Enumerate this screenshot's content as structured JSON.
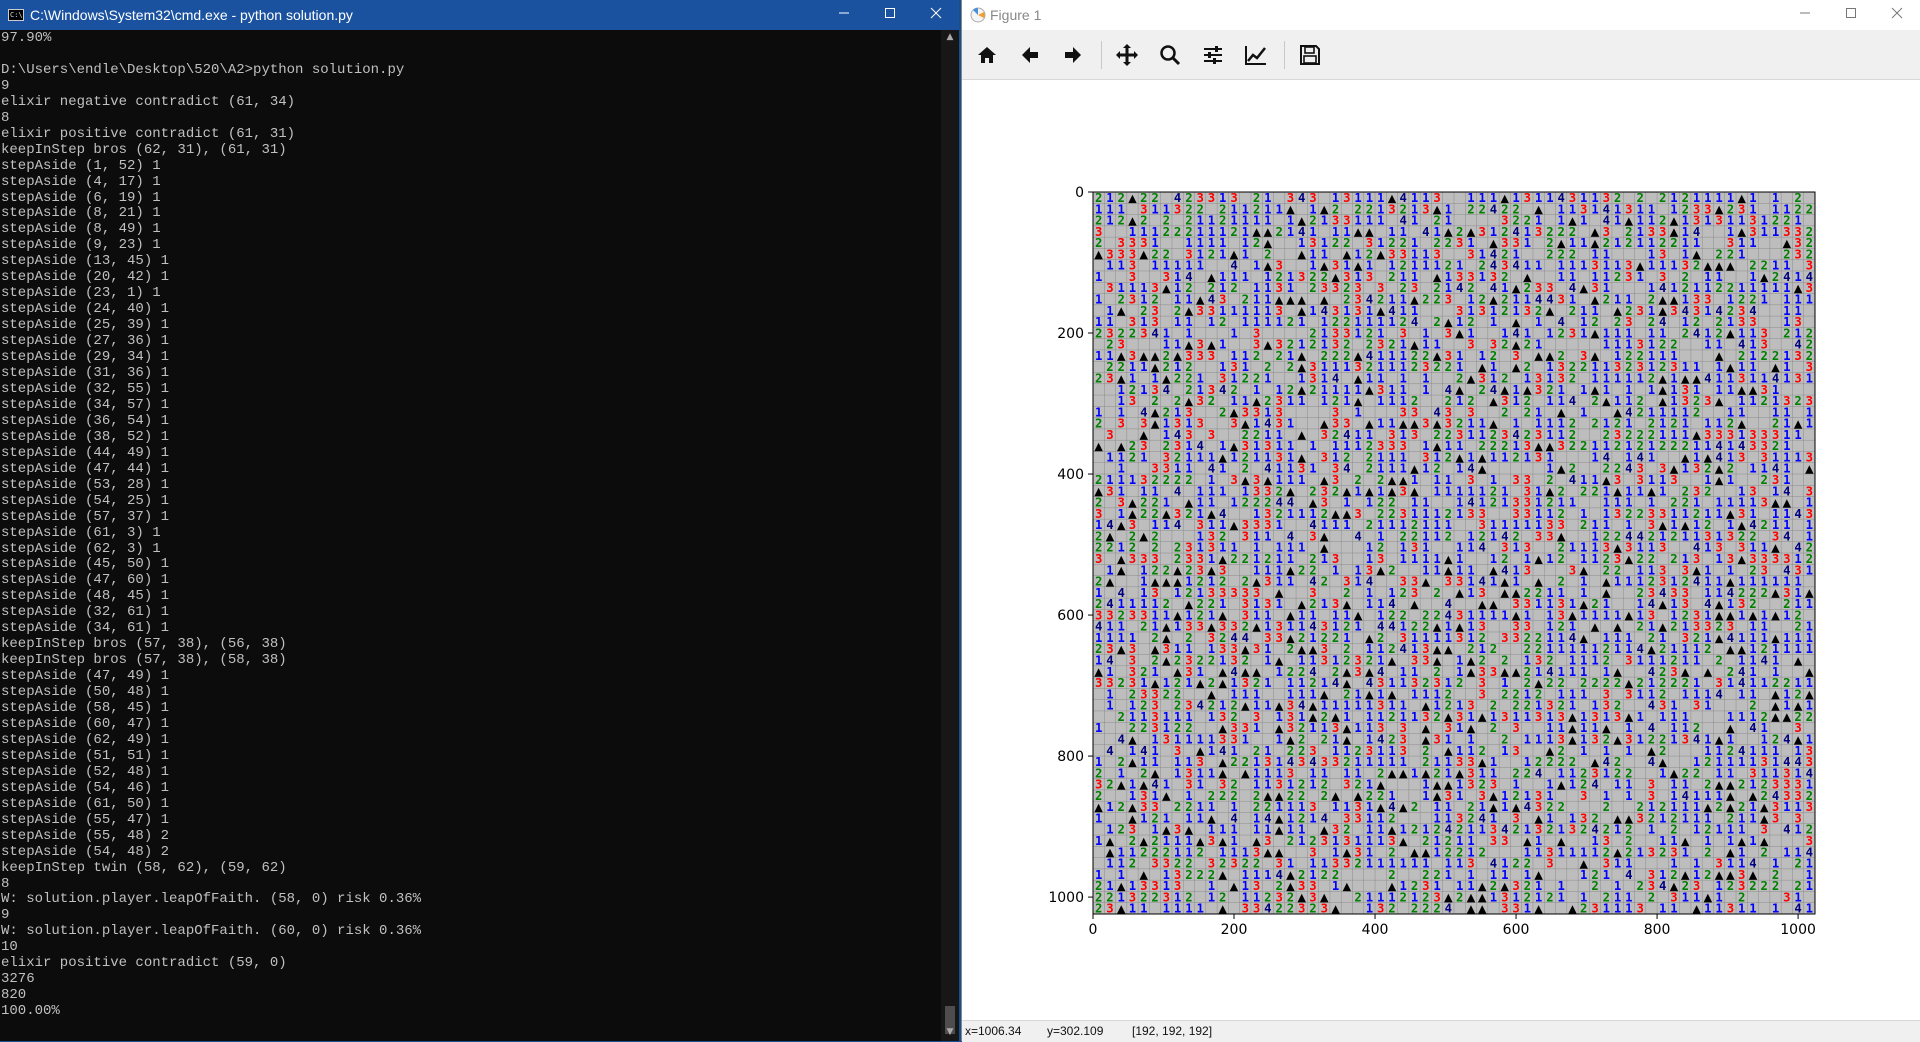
{
  "cmd": {
    "title": "C:\\Windows\\System32\\cmd.exe - python  solution.py",
    "icon_label": "C:\\",
    "lines": [
      "97.90%",
      "",
      "D:\\Users\\endle\\Desktop\\520\\A2>python solution.py",
      "9",
      "elixir negative contradict (61, 34)",
      "8",
      "elixir positive contradict (61, 31)",
      "keepInStep bros (62, 31), (61, 31)",
      "stepAside (1, 52) 1",
      "stepAside (4, 17) 1",
      "stepAside (6, 19) 1",
      "stepAside (8, 21) 1",
      "stepAside (8, 49) 1",
      "stepAside (9, 23) 1",
      "stepAside (13, 45) 1",
      "stepAside (20, 42) 1",
      "stepAside (23, 1) 1",
      "stepAside (24, 40) 1",
      "stepAside (25, 39) 1",
      "stepAside (27, 36) 1",
      "stepAside (29, 34) 1",
      "stepAside (31, 36) 1",
      "stepAside (32, 55) 1",
      "stepAside (34, 57) 1",
      "stepAside (36, 54) 1",
      "stepAside (38, 52) 1",
      "stepAside (44, 49) 1",
      "stepAside (47, 44) 1",
      "stepAside (53, 28) 1",
      "stepAside (54, 25) 1",
      "stepAside (57, 37) 1",
      "stepAside (61, 3) 1",
      "stepAside (62, 3) 1",
      "stepAside (45, 50) 1",
      "stepAside (47, 60) 1",
      "stepAside (48, 45) 1",
      "stepAside (32, 61) 1",
      "stepAside (34, 61) 1",
      "keepInStep bros (57, 38), (56, 38)",
      "keepInStep bros (57, 38), (58, 38)",
      "stepAside (47, 49) 1",
      "stepAside (50, 48) 1",
      "stepAside (58, 45) 1",
      "stepAside (60, 47) 1",
      "stepAside (62, 49) 1",
      "stepAside (51, 51) 1",
      "stepAside (52, 48) 1",
      "stepAside (54, 46) 1",
      "stepAside (61, 50) 1",
      "stepAside (55, 47) 1",
      "stepAside (55, 48) 2",
      "stepAside (54, 48) 2",
      "keepInStep twin (58, 62), (59, 62)",
      "8",
      "W: solution.player.leapOfFaith. (58, 0) risk 0.36%",
      "9",
      "W: solution.player.leapOfFaith. (60, 0) risk 0.36%",
      "10",
      "elixir positive contradict (59, 0)",
      "3276",
      "820",
      "100.00%"
    ]
  },
  "figure": {
    "title": "Figure 1",
    "toolbar": [
      {
        "name": "home-button",
        "icon": "home-icon"
      },
      {
        "name": "back-button",
        "icon": "arrow-left-icon"
      },
      {
        "name": "forward-button",
        "icon": "arrow-right-icon"
      },
      {
        "name": "pan-button",
        "icon": "move-icon"
      },
      {
        "name": "zoom-button",
        "icon": "magnifier-icon"
      },
      {
        "name": "configure-subplots-button",
        "icon": "sliders-icon"
      },
      {
        "name": "edit-axes-button",
        "icon": "line-chart-icon"
      },
      {
        "name": "save-button",
        "icon": "floppy-disk-icon"
      }
    ],
    "status": {
      "x": "x=1006.34",
      "y": "y=302.109",
      "rgb": "[192, 192, 192]"
    },
    "chart_data": {
      "type": "heatmap",
      "description_kind": "minesweeper board image (64x64 cells of 16px tiles)",
      "xlim": [
        0,
        1024
      ],
      "ylim": [
        1024,
        0
      ],
      "x_ticks": [
        "0",
        "200",
        "400",
        "600",
        "800",
        "1000"
      ],
      "y_ticks": [
        "0",
        "200",
        "400",
        "600",
        "800",
        "1000"
      ],
      "grid_cells": 64,
      "cell_colors": {
        "covered": "#c0c0c0",
        "revealed": "#bdbdbd",
        "one": "#0000ff",
        "two": "#008000",
        "three": "#ff0000",
        "four": "#000080",
        "mine_flag": "#ff0000"
      }
    }
  }
}
